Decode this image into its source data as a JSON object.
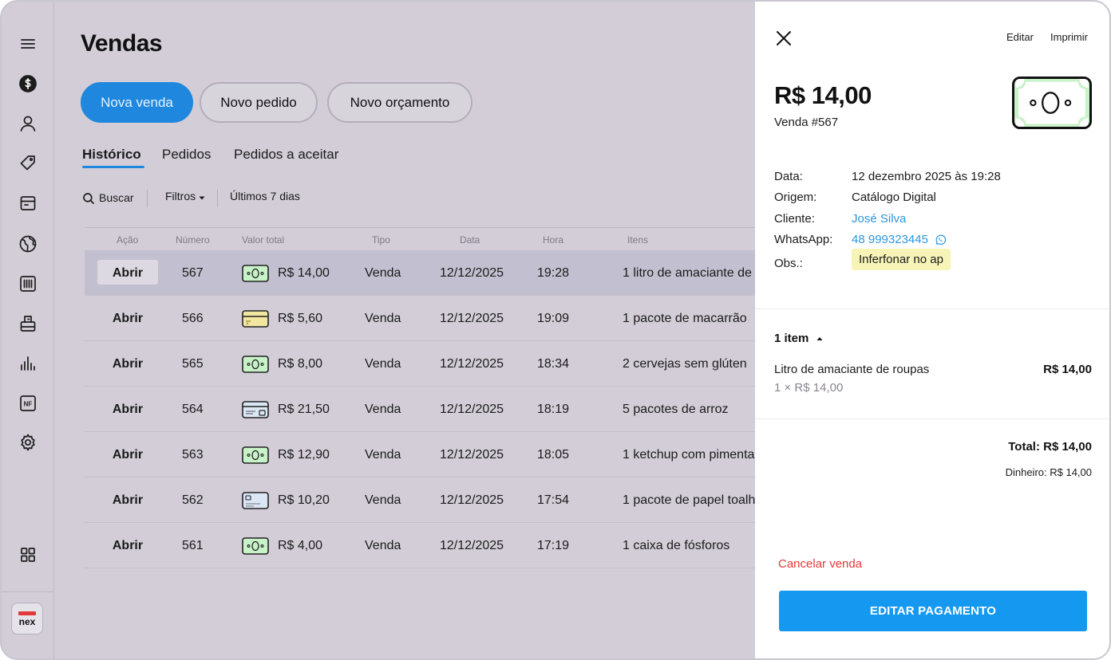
{
  "page": {
    "title": "Vendas"
  },
  "actions": {
    "new_sale": "Nova venda",
    "new_order": "Novo pedido",
    "new_quote": "Novo orçamento"
  },
  "tabs": [
    "Histórico",
    "Pedidos",
    "Pedidos a aceitar"
  ],
  "filters": {
    "search": "Buscar",
    "filters": "Filtros",
    "period": "Últimos 7 dias"
  },
  "table": {
    "headers": [
      "Ação",
      "Número",
      "Valor total",
      "Tipo",
      "Data",
      "Hora",
      "Itens"
    ],
    "rows": [
      {
        "action": "Abrir",
        "number": "567",
        "pay": "cash",
        "value": "R$ 14,00",
        "type": "Venda",
        "date": "12/12/2025",
        "time": "19:28",
        "items": "1 litro de amaciante de"
      },
      {
        "action": "Abrir",
        "number": "566",
        "pay": "voucher",
        "value": "R$ 5,60",
        "type": "Venda",
        "date": "12/12/2025",
        "time": "19:09",
        "items": "1 pacote de macarrão"
      },
      {
        "action": "Abrir",
        "number": "565",
        "pay": "cash",
        "value": "R$ 8,00",
        "type": "Venda",
        "date": "12/12/2025",
        "time": "18:34",
        "items": "2 cervejas sem glúten"
      },
      {
        "action": "Abrir",
        "number": "564",
        "pay": "debit",
        "value": "R$ 21,50",
        "type": "Venda",
        "date": "12/12/2025",
        "time": "18:19",
        "items": "5 pacotes de arroz"
      },
      {
        "action": "Abrir",
        "number": "563",
        "pay": "cash",
        "value": "R$ 12,90",
        "type": "Venda",
        "date": "12/12/2025",
        "time": "18:05",
        "items": "1 ketchup com pimenta"
      },
      {
        "action": "Abrir",
        "number": "562",
        "pay": "credit",
        "value": "R$ 10,20",
        "type": "Venda",
        "date": "12/12/2025",
        "time": "17:54",
        "items": "1 pacote de papel toalh"
      },
      {
        "action": "Abrir",
        "number": "561",
        "pay": "cash",
        "value": "R$ 4,00",
        "type": "Venda",
        "date": "12/12/2025",
        "time": "17:19",
        "items": "1 caixa de fósforos"
      }
    ]
  },
  "panel": {
    "edit": "Editar",
    "print": "Imprimir",
    "amount": "R$ 14,00",
    "sale_number": "Venda #567",
    "info": {
      "date_label": "Data:",
      "date_value": "12 dezembro 2025 às 19:28",
      "origin_label": "Origem:",
      "origin_value": "Catálogo Digital",
      "client_label": "Cliente:",
      "client_value": "José Silva",
      "whatsapp_label": "WhatsApp:",
      "whatsapp_value": "48 999323445",
      "obs_label": "Obs.:",
      "obs_value": "Inferfonar no ap"
    },
    "items_count": "1 item",
    "item": {
      "name": "Litro de amaciante de roupas",
      "qty": "1 × R$ 14,00",
      "price": "R$ 14,00"
    },
    "total": "Total: R$ 14,00",
    "cash": "Dinheiro: R$ 14,00",
    "cancel": "Cancelar venda",
    "edit_payment": "EDITAR PAGAMENTO"
  },
  "brand": {
    "logo_text": "nex",
    "accent": "#1f88de",
    "danger": "#e03a3a"
  },
  "icons": {
    "sidebar": [
      "menu-icon",
      "dollar-icon",
      "user-icon",
      "tag-icon",
      "box-icon",
      "globe-icon",
      "barcode-icon",
      "register-icon",
      "chart-icon",
      "nf-icon",
      "gear-icon",
      "apps-icon"
    ]
  }
}
